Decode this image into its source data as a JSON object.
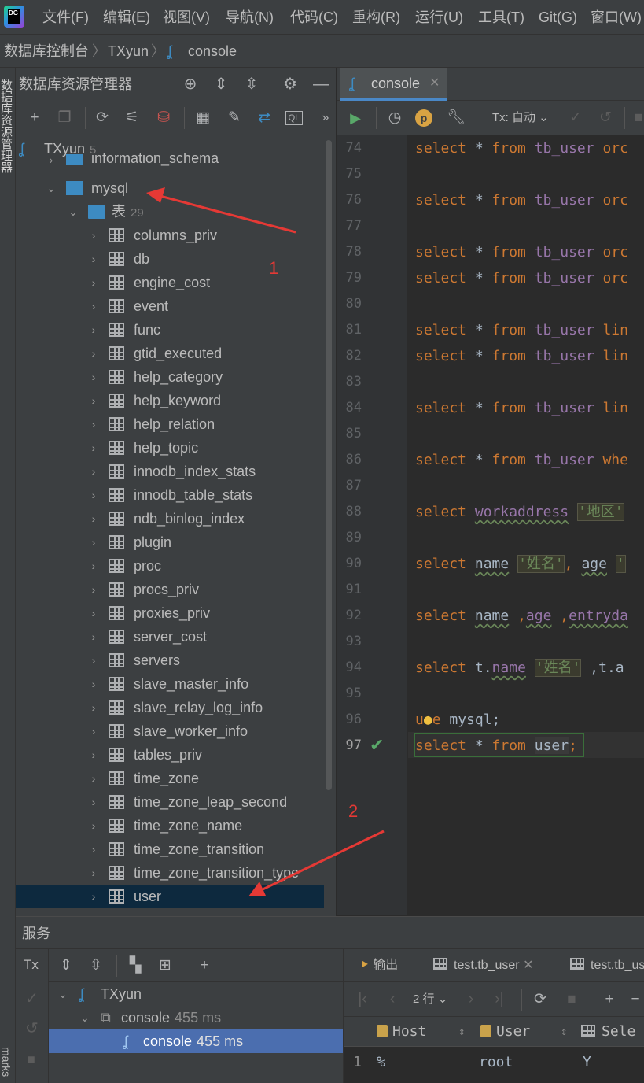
{
  "app": {
    "logo_text": "DG",
    "menu": [
      "文件(F)",
      "编辑(E)",
      "视图(V)",
      "导航(N)",
      "代码(C)",
      "重构(R)",
      "运行(U)",
      "工具(T)",
      "Git(G)",
      "窗口(W)"
    ]
  },
  "breadcrumb": [
    "数据库控制台",
    "TXyun",
    "console"
  ],
  "left_stripe": {
    "db_explorer_label": "数据库资源管理器",
    "bookmarks_label": "marks"
  },
  "db_explorer": {
    "title": "数据库资源管理器",
    "root": {
      "label": "TXyun",
      "count": "5"
    },
    "schema_partial": "information_schema",
    "schema": "mysql",
    "tables_folder": {
      "label": "表",
      "count": "29"
    },
    "tables": [
      "columns_priv",
      "db",
      "engine_cost",
      "event",
      "func",
      "gtid_executed",
      "help_category",
      "help_keyword",
      "help_relation",
      "help_topic",
      "innodb_index_stats",
      "innodb_table_stats",
      "ndb_binlog_index",
      "plugin",
      "proc",
      "procs_priv",
      "proxies_priv",
      "server_cost",
      "servers",
      "slave_master_info",
      "slave_relay_log_info",
      "slave_worker_info",
      "tables_priv",
      "time_zone",
      "time_zone_leap_second",
      "time_zone_name",
      "time_zone_transition",
      "time_zone_transition_type",
      "user"
    ],
    "selected_table": "user"
  },
  "editor": {
    "tab_label": "console",
    "tx_label": "Tx: 自动",
    "line_numbers": [
      "74",
      "75",
      "76",
      "77",
      "78",
      "79",
      "80",
      "81",
      "82",
      "83",
      "84",
      "85",
      "86",
      "87",
      "88",
      "89",
      "90",
      "91",
      "92",
      "93",
      "94",
      "95",
      "96",
      "97"
    ],
    "current_line": "97",
    "code": {
      "l74": {
        "kw": "select",
        "rest": " * ",
        "kw2": "from",
        "tbl": "tb_user",
        "tail": "orc"
      },
      "l76": {
        "kw": "select",
        "rest": " * ",
        "kw2": "from",
        "tbl": "tb_user",
        "tail": "orc"
      },
      "l78": {
        "kw": "select",
        "rest": " * ",
        "kw2": "from",
        "tbl": "tb_user",
        "tail": "orc"
      },
      "l79": {
        "kw": "select",
        "rest": " * ",
        "kw2": "from",
        "tbl": "tb_user",
        "tail": "orc"
      },
      "l81": {
        "kw": "select",
        "rest": " * ",
        "kw2": "from",
        "tbl": "tb_user",
        "tail": "lin"
      },
      "l82": {
        "kw": "select",
        "rest": " * ",
        "kw2": "from",
        "tbl": "tb_user",
        "tail": "lin"
      },
      "l84": {
        "kw": "select",
        "rest": " * ",
        "kw2": "from",
        "tbl": "tb_user",
        "tail": "lin"
      },
      "l86": {
        "kw": "select",
        "rest": " * ",
        "kw2": "from",
        "tbl": "tb_user",
        "tail": "whe"
      },
      "l88": {
        "kw": "select",
        "col": "workaddress",
        "str": "'地区'"
      },
      "l90": {
        "kw": "select",
        "col": "name",
        "str": "'姓名'",
        "col2": "age",
        "tail": "'"
      },
      "l92": {
        "kw": "select",
        "col": "name",
        "col2": "age",
        "col3": "entryda"
      },
      "l94": {
        "kw": "select",
        "prefix": "t.",
        "col": "name",
        "str": "'姓名'",
        "tail": ",t.a"
      },
      "l96": {
        "kw_a": "u",
        "kw_b": "e",
        "rest": " mysql;"
      },
      "l97": {
        "kw": "select",
        "rest": " * ",
        "kw2": "from",
        "tbl": "user",
        "end": ";"
      }
    }
  },
  "annotations": {
    "one": "1",
    "two": "2"
  },
  "services": {
    "title": "服务",
    "tx_label": "Tx",
    "tree": [
      {
        "label": "TXyun",
        "ms": ""
      },
      {
        "label": "console",
        "ms": "455 ms"
      },
      {
        "label": "console",
        "ms": "455 ms"
      }
    ],
    "result_tabs": [
      "输出",
      "test.tb_user",
      "test.tb_us"
    ],
    "rows_label": "2 行",
    "columns": [
      "Host",
      "User",
      "Sele"
    ],
    "rows": [
      {
        "num": "1",
        "host": "%",
        "user": "root",
        "sele": "Y"
      }
    ]
  },
  "colors": {
    "keyword": "#cc7832",
    "table": "#9876aa",
    "annotation": "#e53935",
    "selection": "#0d293e"
  }
}
